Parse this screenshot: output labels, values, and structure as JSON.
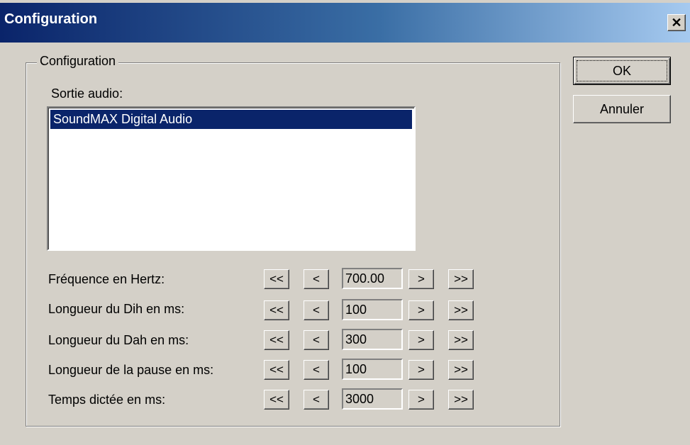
{
  "window": {
    "title": "Configuration",
    "close_symbol": "✕"
  },
  "group": {
    "legend": "Configuration",
    "audio_output_label": "Sortie audio:",
    "audio_devices": [
      "SoundMAX Digital Audio"
    ],
    "selected_device": "SoundMAX Digital Audio"
  },
  "settings": [
    {
      "label": "Fréquence en Hertz:",
      "value": "700.00"
    },
    {
      "label": "Longueur du Dih en ms:",
      "value": "100"
    },
    {
      "label": "Longueur du Dah en ms:",
      "value": "300"
    },
    {
      "label": "Longueur de la pause en ms:",
      "value": "100"
    },
    {
      "label": "Temps dictée en ms:",
      "value": "3000"
    }
  ],
  "stepper": {
    "fast_decrease": "<<",
    "decrease": "<",
    "increase": ">",
    "fast_increase": ">>"
  },
  "buttons": {
    "ok": "OK",
    "cancel": "Annuler"
  }
}
